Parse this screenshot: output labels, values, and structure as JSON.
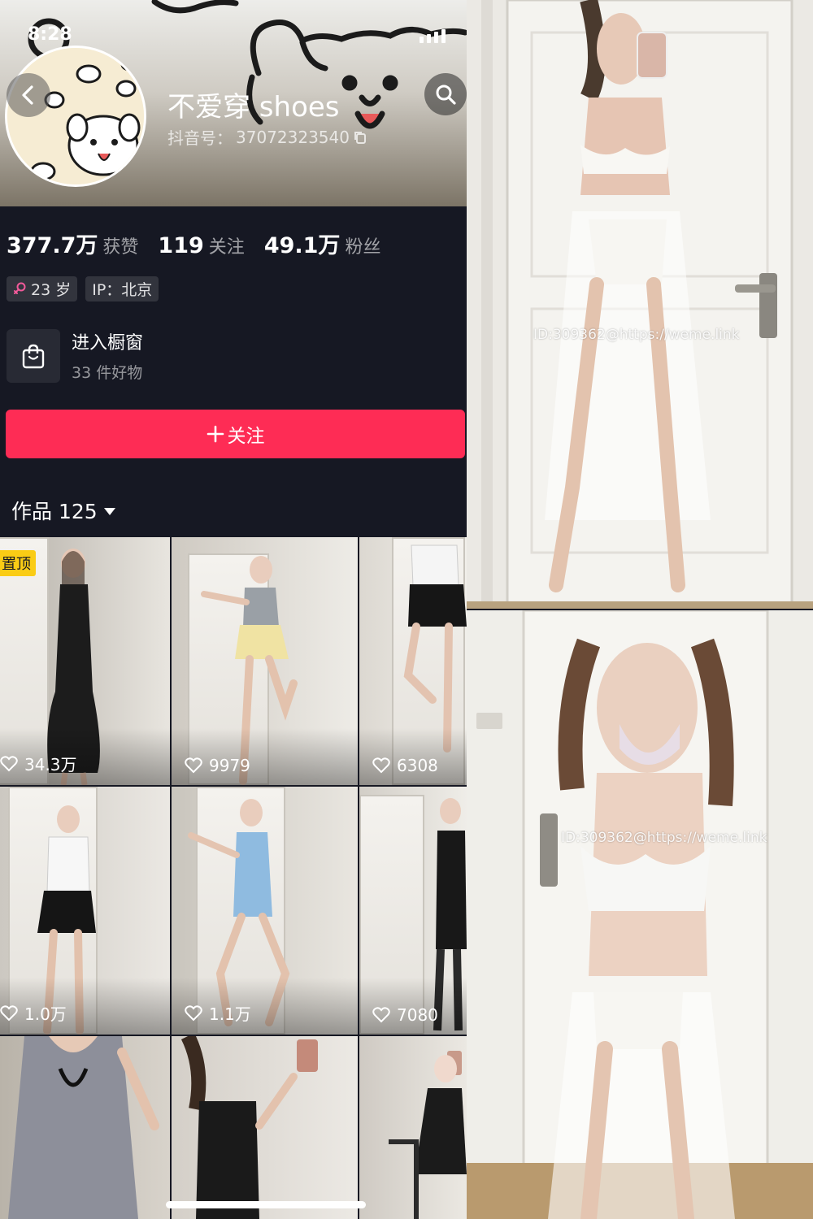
{
  "status": {
    "time": "8:28"
  },
  "profile": {
    "username": "不爱穿 shoes",
    "id_label": "抖音号：",
    "id_value": "37072323540"
  },
  "stats": [
    {
      "value": "377.7万",
      "label": "获赞"
    },
    {
      "value": "119",
      "label": "关注"
    },
    {
      "value": "49.1万",
      "label": "粉丝"
    }
  ],
  "tags": {
    "age": "23 岁",
    "ip": "IP：北京"
  },
  "shop": {
    "title": "进入橱窗",
    "subtitle": "33 件好物"
  },
  "follow_button": {
    "label": "关注"
  },
  "works_tab": {
    "label": "作品 125"
  },
  "videos": [
    {
      "likes": "34.3万",
      "pinned_label": "置顶"
    },
    {
      "likes": "9979"
    },
    {
      "likes": "6308"
    },
    {
      "likes": "1.0万"
    },
    {
      "likes": "1.1万"
    },
    {
      "likes": "7080"
    },
    {
      "likes": ""
    },
    {
      "likes": ""
    },
    {
      "likes": ""
    }
  ],
  "photos": {
    "top_watermark": "ID:309362@https://weme.link",
    "bottom_watermark": "ID:309362@https://weme.link"
  },
  "colors": {
    "accent": "#fe2c55",
    "background": "#161823",
    "pin": "#facc15"
  },
  "icons": [
    "back-arrow-icon",
    "search-icon",
    "copy-icon",
    "female-icon",
    "shopping-bag-icon",
    "plus-icon",
    "heart-icon"
  ]
}
